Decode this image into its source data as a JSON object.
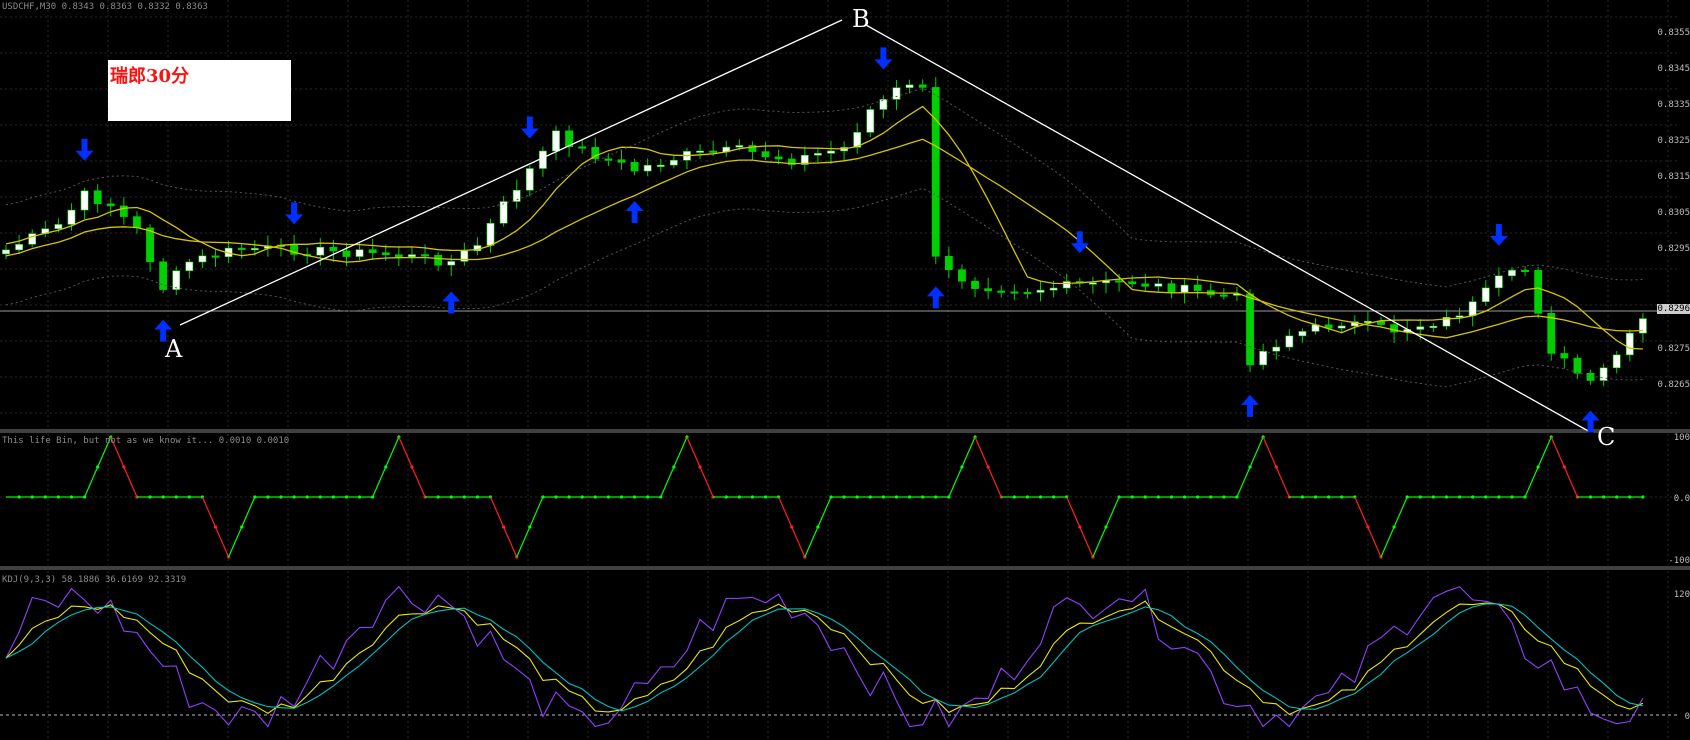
{
  "window": {
    "symbol_info": "USDCHF,M30  0.8343 0.8363 0.8332 0.8363",
    "annotation_label": "瑞郎30分"
  },
  "chart_data": [
    {
      "type": "candlestick",
      "title": "USDCHF,M30",
      "note": "Price panel with two yellow moving averages, dotted grey bands, and a hand-drawn A-B-C trendline pattern.",
      "points": [
        {
          "label": "A"
        },
        {
          "label": "B"
        },
        {
          "label": "C"
        }
      ],
      "arrows": [
        {
          "index": 6,
          "dir": "down"
        },
        {
          "index": 12,
          "dir": "up"
        },
        {
          "index": 22,
          "dir": "down"
        },
        {
          "index": 34,
          "dir": "up"
        },
        {
          "index": 40,
          "dir": "down"
        },
        {
          "index": 48,
          "dir": "up"
        },
        {
          "index": 67,
          "dir": "down"
        },
        {
          "index": 71,
          "dir": "up"
        },
        {
          "index": 82,
          "dir": "down"
        },
        {
          "index": 95,
          "dir": "up"
        },
        {
          "index": 114,
          "dir": "down"
        },
        {
          "index": 121,
          "dir": "up"
        }
      ],
      "colors": {
        "up": "#ffffff",
        "down": "#00d000",
        "ma": "#d4c400",
        "trendline": "#ffffff",
        "arrow": "#0030ff"
      },
      "grid": true
    },
    {
      "type": "line",
      "title": "",
      "info": "This life Bin, but not as we know it... 0.0010 0.0010",
      "ylim": [
        -100,
        100
      ],
      "ticks": [
        "100",
        "0.0",
        "-100"
      ],
      "note": "Oscillator that rises stepwise (green) to +100 then falls (red) to -100, flat at 0 in between",
      "colors": {
        "up": "#00ff00",
        "down": "#ff2020"
      }
    },
    {
      "type": "line",
      "title": "KDJ(9,3,3)",
      "info": "KDJ(9,3,3) 58.1886 36.6169 92.3319",
      "ylim": [
        0,
        120
      ],
      "ticks": [
        "120",
        "0"
      ],
      "series": [
        {
          "name": "K",
          "color": "#e8e800"
        },
        {
          "name": "D",
          "color": "#00c0c0"
        },
        {
          "name": "J",
          "color": "#9040ff"
        }
      ]
    }
  ],
  "right_labels": {
    "price": [
      "0.8355",
      "0.8345",
      "0.8335",
      "0.8325",
      "0.8315",
      "0.8305",
      "0.8295",
      "0.8285",
      "0.8275",
      "0.8265"
    ],
    "price_current": "0.8296"
  }
}
